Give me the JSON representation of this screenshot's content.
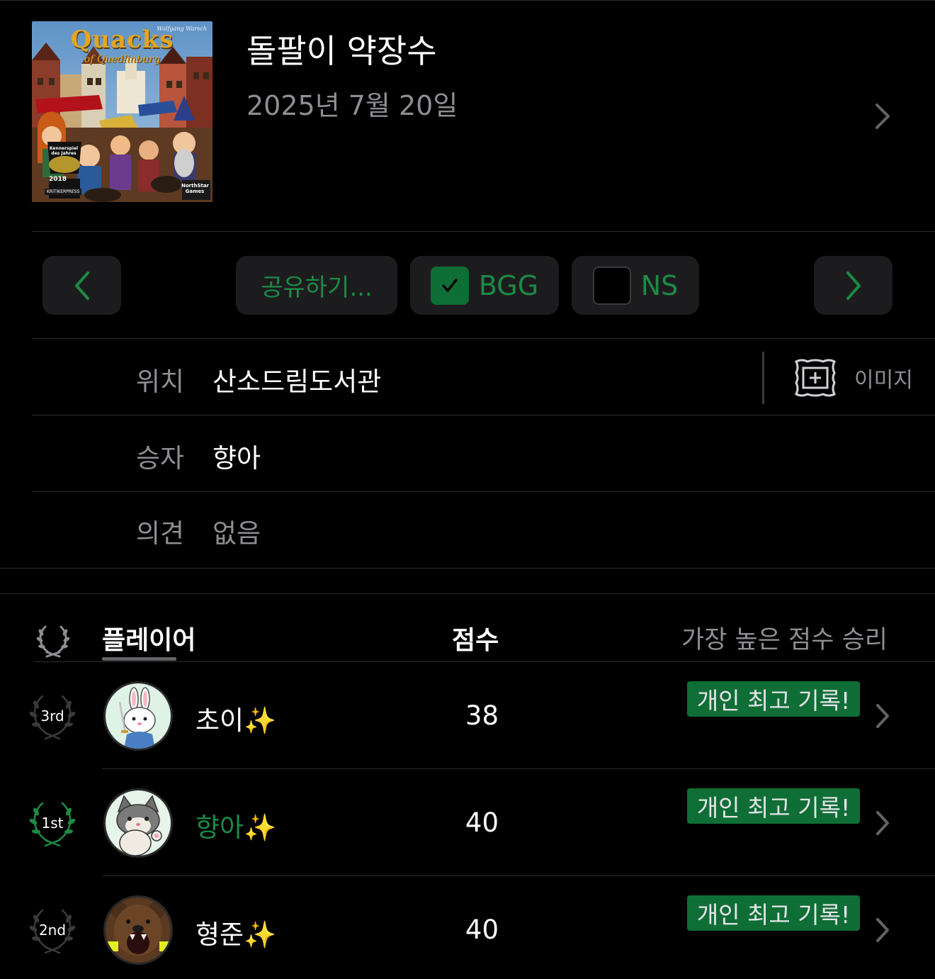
{
  "game": {
    "title": "돌팔이 약장수",
    "date": "2025년 7월 20일",
    "cover": {
      "title": "Quacks",
      "subtitle": "of Quedlinburg",
      "author": "Wolfgang Warsch",
      "award": "Kennerspiel des Jahres",
      "year": "2018",
      "publisher": "KRITIKERPRESS",
      "publisher2": "NorthStar Games"
    }
  },
  "toolbar": {
    "prev_icon": "chevron-left-icon",
    "share_label": "공유하기...",
    "bgg_label": "BGG",
    "bgg_checked": true,
    "ns_label": "NS",
    "ns_checked": false,
    "next_icon": "chevron-right-icon",
    "accent_color": "#1c8a45"
  },
  "details": {
    "location_label": "위치",
    "location_value": "산소드림도서관",
    "image_button_label": "이미지",
    "winner_label": "승자",
    "winner_value": "향아",
    "comment_label": "의견",
    "comment_value": "없음"
  },
  "players_table": {
    "header_player": "플레이어",
    "header_score": "점수",
    "header_rule": "가장 높은 점수 승리",
    "rows": [
      {
        "rank": "3rd",
        "name": "초이✨",
        "score": "38",
        "badge": "개인 최고 기록!",
        "winner": false,
        "avatar": "bunny-avatar"
      },
      {
        "rank": "1st",
        "name": "향아✨",
        "score": "40",
        "badge": "개인 최고 기록!",
        "winner": true,
        "avatar": "cat-avatar"
      },
      {
        "rank": "2nd",
        "name": "형준✨",
        "score": "40",
        "badge": "개인 최고 기록!",
        "winner": false,
        "avatar": "bear-avatar"
      }
    ]
  }
}
